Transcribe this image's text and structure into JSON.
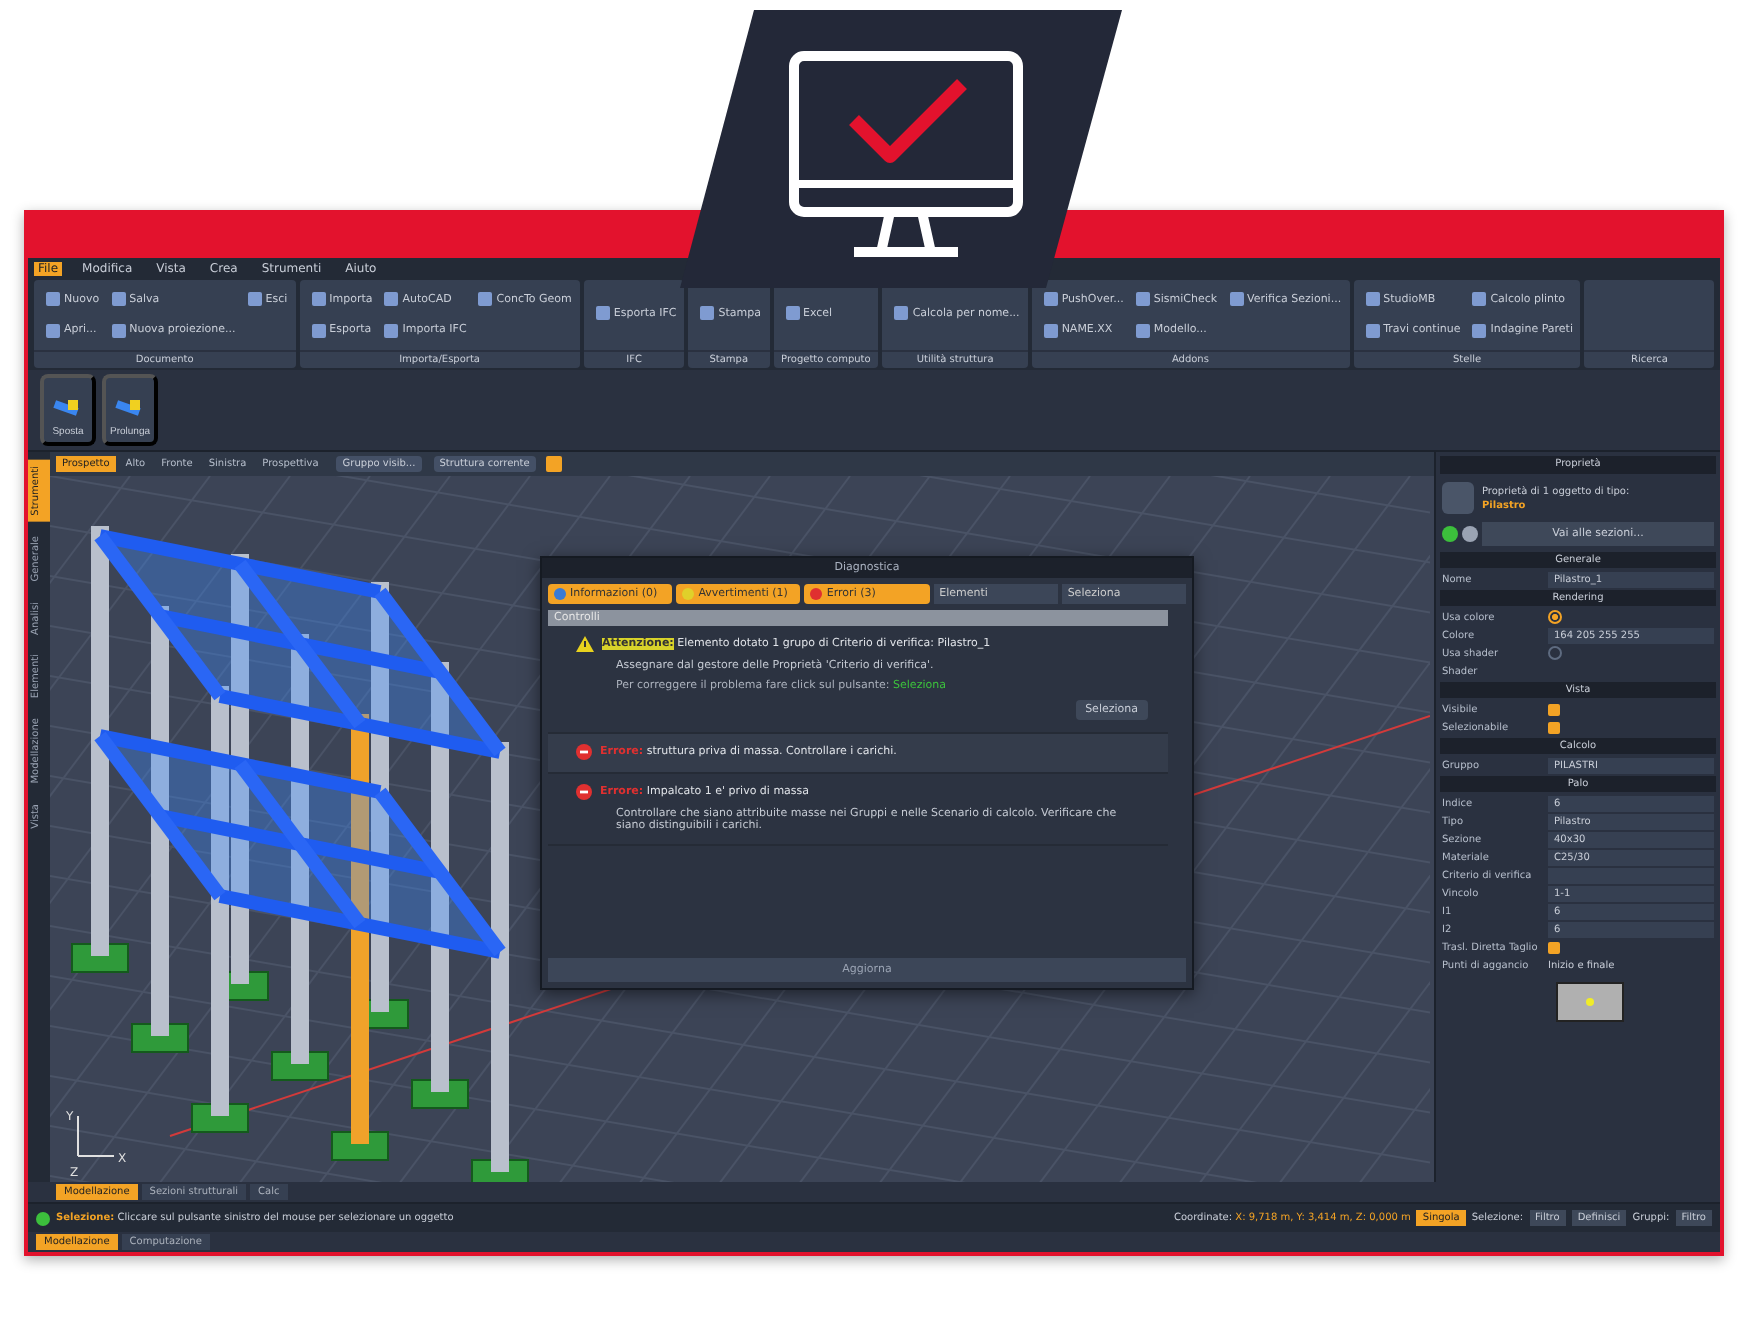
{
  "menu": [
    {
      "label": "File",
      "selected": true
    },
    {
      "label": "Modifica",
      "selected": false
    },
    {
      "label": "Vista",
      "selected": false
    },
    {
      "label": "Crea",
      "selected": false
    },
    {
      "label": "Strumenti",
      "selected": false
    },
    {
      "label": "Aiuto",
      "selected": false
    }
  ],
  "ribbon": [
    {
      "label": "Documento",
      "items": [
        "Nuovo",
        "Salva",
        "Esci",
        "Apri...",
        "Nuova proiezione..."
      ]
    },
    {
      "label": "Importa/Esporta",
      "items": [
        "Importa",
        "AutoCAD",
        "ConcTo Geom",
        "Esporta",
        "Importa IFC"
      ]
    },
    {
      "label": "IFC",
      "items": [
        "Esporta IFC"
      ]
    },
    {
      "label": "Stampa",
      "items": [
        "Stampa"
      ]
    },
    {
      "label": "Progetto computo",
      "items": [
        "Excel"
      ]
    },
    {
      "label": "Utilità struttura",
      "items": [
        "Calcola per nome..."
      ]
    },
    {
      "label": "Addons",
      "items": [
        "PushOver...",
        "SismiCheck",
        "Verifica Sezioni...",
        "NAME.XX",
        "Modello..."
      ]
    },
    {
      "label": "Stelle",
      "items": [
        "StudioMB",
        "Calcolo plinto",
        "Travi continue",
        "Indagine Pareti"
      ]
    },
    {
      "label": "Ricerca"
    }
  ],
  "toolbar": [
    "Sposta",
    "Prolunga"
  ],
  "side_tabs": [
    {
      "label": "Strumenti",
      "selected": true
    },
    {
      "label": "Generale",
      "selected": false
    },
    {
      "label": "Analisi",
      "selected": false
    },
    {
      "label": "Elementi",
      "selected": false
    },
    {
      "label": "Modellazione",
      "selected": false
    },
    {
      "label": "Vista",
      "selected": false
    }
  ],
  "viewport": {
    "tabs": [
      {
        "label": "Prospetto",
        "selected": true
      },
      {
        "label": "Alto",
        "selected": false
      },
      {
        "label": "Fronte",
        "selected": false
      },
      {
        "label": "Sinistra",
        "selected": false
      },
      {
        "label": "Prospettiva",
        "selected": false
      }
    ],
    "group_combo": "Gruppo visib...",
    "structure_combo": "Struttura corrente",
    "axes": [
      "Y",
      "X",
      "Z"
    ]
  },
  "dialog": {
    "title": "Diagnostica",
    "filters": [
      {
        "label": "Informazioni (0)",
        "selected": true,
        "kind": "info"
      },
      {
        "label": "Avvertimenti (1)",
        "selected": true,
        "kind": "warning"
      },
      {
        "label": "Errori (3)",
        "selected": true,
        "kind": "error"
      }
    ],
    "scope": "Elementi",
    "select_all": "Seleziona",
    "section": "Controlli",
    "messages": [
      {
        "kind": "warning",
        "tag": "Attenzione:",
        "text": "Elemento dotato 1 grupo di Criterio di verifica: Pilastro_1",
        "detail": "Assegnare dal gestore delle Proprietà 'Criterio di verifica'.",
        "hint": "Per correggere il problema fare click sul pulsante:",
        "hint_action": "Seleziona",
        "button": "Seleziona"
      },
      {
        "kind": "error",
        "tag": "Errore:",
        "text": "struttura priva di massa. Controllare i carichi."
      },
      {
        "kind": "error",
        "tag": "Errore:",
        "text": "Impalcato 1 e' privo di massa",
        "detail": "Controllare che siano attribuite masse nei Gruppi e nelle Scenario di calcolo. Verificare che siano distinguibili i carichi."
      }
    ],
    "refresh": "Aggiorna"
  },
  "properties": {
    "title": "Proprietà",
    "summary": "Proprietà di 1 oggetto di tipo:",
    "object_type": "Pilastro",
    "goto": "Vai alle sezioni...",
    "sections": [
      {
        "title": "Generale",
        "rows": [
          {
            "label": "Nome",
            "kind": "field",
            "value": "Pilastro_1"
          }
        ]
      },
      {
        "title": "Rendering",
        "rows": [
          {
            "label": "Usa colore",
            "kind": "radio",
            "checked": true
          },
          {
            "label": "Colore",
            "kind": "field",
            "value": "164 205 255 255"
          },
          {
            "label": "Usa shader",
            "kind": "radio",
            "checked": false
          },
          {
            "label": "Shader",
            "kind": "label"
          }
        ]
      },
      {
        "title": "Vista",
        "rows": [
          {
            "label": "Visibile",
            "kind": "check",
            "checked": true
          },
          {
            "label": "Selezionabile",
            "kind": "check",
            "checked": true
          }
        ]
      },
      {
        "title": "Calcolo",
        "rows": [
          {
            "label": "Gruppo",
            "kind": "field",
            "value": "PILASTRI"
          }
        ]
      },
      {
        "title": "Palo",
        "rows": [
          {
            "label": "Indice",
            "kind": "field",
            "value": "6"
          },
          {
            "label": "Tipo",
            "kind": "field",
            "value": "Pilastro"
          },
          {
            "label": "Sezione",
            "kind": "field",
            "value": "40x30"
          },
          {
            "label": "Materiale",
            "kind": "field",
            "value": "C25/30"
          },
          {
            "label": "Criterio di verifica",
            "kind": "field"
          },
          {
            "label": "Vincolo",
            "kind": "field",
            "value": "1-1"
          },
          {
            "label": "I1",
            "kind": "field",
            "value": "6"
          },
          {
            "label": "I2",
            "kind": "field",
            "value": "6"
          },
          {
            "label": "Trasl. Diretta Taglio",
            "kind": "check",
            "checked": true
          },
          {
            "label": "Punti di aggancio",
            "kind": "label",
            "value": "Inizio e finale"
          }
        ]
      }
    ]
  },
  "bottom_tabs": [
    {
      "label": "Modellazione",
      "selected": true
    },
    {
      "label": "Sezioni strutturali",
      "selected": false
    },
    {
      "label": "Calc",
      "selected": false
    }
  ],
  "status": {
    "label": "Selezione:",
    "message": "Cliccare sul pulsante sinistro del mouse per selezionare un oggetto",
    "coords_label": "Coordinate:",
    "coords": "X: 9,718 m, Y: 3,414 m, Z: 0,000 m",
    "mode": "Singola",
    "selection_label": "Selezione:",
    "filter": "Filtro",
    "define": "Definisci",
    "groups_label": "Gruppi:",
    "groups_filter": "Filtro"
  },
  "footer_tabs": [
    {
      "label": "Modellazione",
      "selected": true
    },
    {
      "label": "Computazione",
      "selected": false
    }
  ]
}
